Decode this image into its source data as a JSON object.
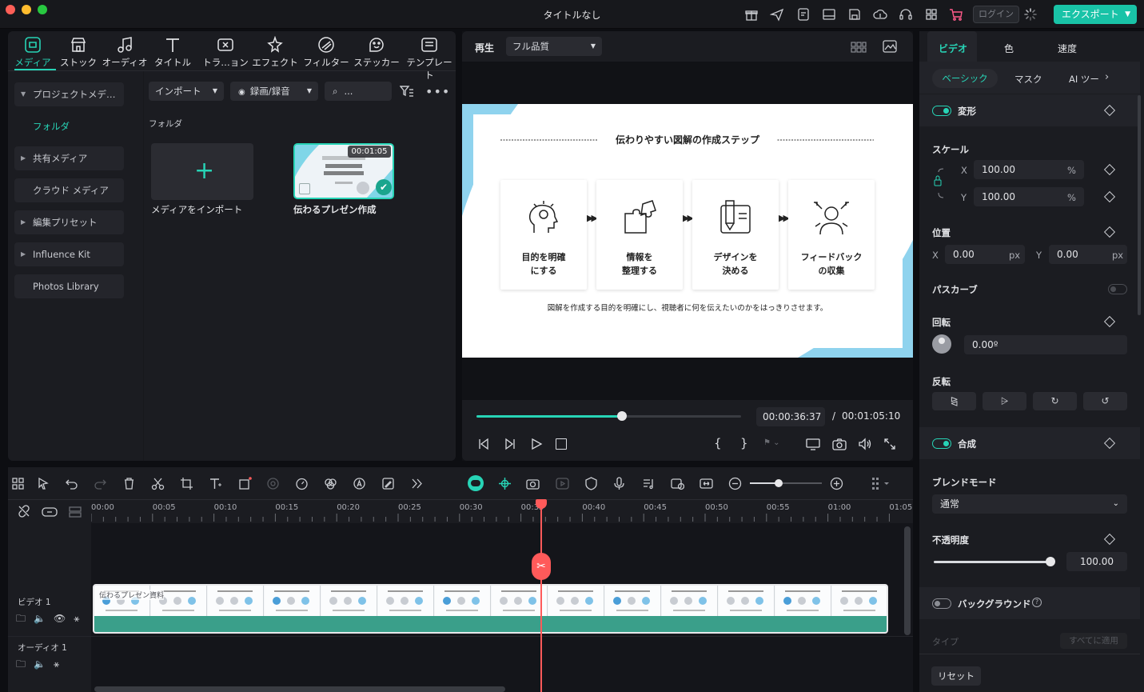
{
  "window": {
    "title": "タイトルなし",
    "login_label": "ログイン",
    "export_label": "エクスポート"
  },
  "media_tabs": [
    {
      "label": "メディア",
      "icon": "media-icon"
    },
    {
      "label": "ストック",
      "icon": "store-icon"
    },
    {
      "label": "オーディオ",
      "icon": "music-note-icon"
    },
    {
      "label": "タイトル",
      "icon": "title-t-icon"
    },
    {
      "label": "トラ…ョン",
      "icon": "transition-icon"
    },
    {
      "label": "エフェクト",
      "icon": "effect-icon"
    },
    {
      "label": "フィルター",
      "icon": "filter-icon"
    },
    {
      "label": "ステッカー",
      "icon": "sticker-icon"
    },
    {
      "label": "テンプレート",
      "icon": "template-icon"
    }
  ],
  "sidebar": {
    "project_media": "プロジェクトメデ…",
    "folder": "フォルダ",
    "shared_media": "共有メディア",
    "cloud_media": "クラウド メディア",
    "edit_presets": "編集プリセット",
    "influence_kit": "Influence Kit",
    "photos_library": "Photos Library"
  },
  "media_toolbar": {
    "import_label": "インポート",
    "record_label": "録画/録音",
    "search_placeholder": "..."
  },
  "media_area": {
    "folder_heading": "フォルダ",
    "import_tile_label": "メディアをインポート",
    "clip": {
      "name": "伝わるプレゼン作成",
      "duration": "00:01:05"
    }
  },
  "player": {
    "play_label": "再生",
    "quality": "フル品質",
    "current_time": "00:00:36:37",
    "total_time": "00:01:05:10",
    "time_separator": "/",
    "progress": 0.55,
    "slide": {
      "title": "伝わりやすい図解の作成ステップ",
      "steps": [
        {
          "line1": "目的を明確",
          "line2": "にする",
          "icon": "head-idea-icon"
        },
        {
          "line1": "情報を",
          "line2": "整理する",
          "icon": "puzzle-icon"
        },
        {
          "line1": "デザインを",
          "line2": "決める",
          "icon": "design-tools-icon"
        },
        {
          "line1": "フィードバック",
          "line2": "の収集",
          "icon": "feedback-person-icon"
        }
      ],
      "caption": "図解を作成する目的を明確にし、視聴者に何を伝えたいのかをはっきりさせます。"
    }
  },
  "properties": {
    "tabs": [
      "ビデオ",
      "色",
      "速度"
    ],
    "subtabs": [
      "ベーシック",
      "マスク",
      "AI ツー"
    ],
    "transform": "変形",
    "scale": "スケール",
    "scale_x": "100.00",
    "scale_y": "100.00",
    "position": "位置",
    "pos_x": "0.00",
    "pos_y": "0.00",
    "path_curve": "パスカーブ",
    "rotation": "回転",
    "rotation_value": "0.00º",
    "flip": "反転",
    "composite": "合成",
    "blend_mode": "ブレンドモード",
    "blend_value": "通常",
    "opacity": "不透明度",
    "opacity_value": "100.00",
    "opacity_level": 1.0,
    "background": "バックグラウンド",
    "type_label": "タイプ",
    "apply_all": "すべてに適用",
    "reset": "リセット",
    "x_label": "X",
    "y_label": "Y",
    "percent": "%",
    "px": "px"
  },
  "timeline": {
    "ticks": [
      "00:00",
      "00:05",
      "00:10",
      "00:15",
      "00:20",
      "00:25",
      "00:30",
      "00:35",
      "00:40",
      "00:45",
      "00:50",
      "00:55",
      "01:00",
      "01:05"
    ],
    "video_track": "ビデオ 1",
    "audio_track": "オーディオ 1",
    "clip_title": "伝わるプレゼン資料"
  },
  "colors": {
    "accent": "#27d4b6",
    "playhead": "#ff5a5a",
    "export": "#19c3a7"
  }
}
